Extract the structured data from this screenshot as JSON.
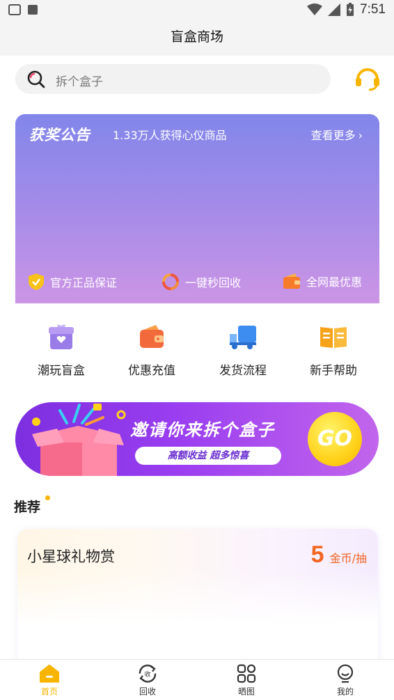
{
  "status_bar": {
    "time": "7:51",
    "battery_icon": "battery-charging-icon",
    "signal_icon": "cell-signal-icon",
    "wifi_icon": "wifi-icon"
  },
  "header": {
    "title": "盲盒商场"
  },
  "search": {
    "placeholder": "拆个盒子",
    "icon": "search-icon"
  },
  "support": {
    "icon": "headset-icon",
    "color": "#f7b500"
  },
  "banner": {
    "title": "获奖公告",
    "subtitle": "1.33万人获得心仪商品",
    "more": "查看更多",
    "guarantees": [
      {
        "label": "官方正品保证",
        "icon": "shield-check-icon",
        "color": "#f7c31a"
      },
      {
        "label": "一键秒回收",
        "icon": "recycle-icon",
        "color": "#f0563b"
      },
      {
        "label": "全网最优惠",
        "icon": "wallet-icon",
        "color": "#f77b2b"
      }
    ]
  },
  "quick_links": [
    {
      "label": "潮玩盲盒",
      "icon": "gift-box-icon"
    },
    {
      "label": "优惠充值",
      "icon": "wallet-icon"
    },
    {
      "label": "发货流程",
      "icon": "truck-icon"
    },
    {
      "label": "新手帮助",
      "icon": "book-icon"
    }
  ],
  "invite": {
    "title": "邀请你来拆个盒子",
    "tagline": "高额收益  超多惊喜",
    "go": "GO"
  },
  "recommend": {
    "title": "推荐",
    "items": [
      {
        "name": "小星球礼物赏",
        "price": "5",
        "unit": "金币/抽"
      }
    ]
  },
  "bottom_nav": [
    {
      "label": "首页",
      "icon": "home-icon",
      "active": true
    },
    {
      "label": "回收",
      "icon": "recycle-icon",
      "active": false
    },
    {
      "label": "晒图",
      "icon": "grid-icon",
      "active": false
    },
    {
      "label": "我的",
      "icon": "profile-icon",
      "active": false
    }
  ],
  "colors": {
    "accent": "#f7b500",
    "price": "#f26522",
    "banner_start": "#8286ea",
    "banner_end": "#cc95e6",
    "invite": "#8b35e8"
  }
}
